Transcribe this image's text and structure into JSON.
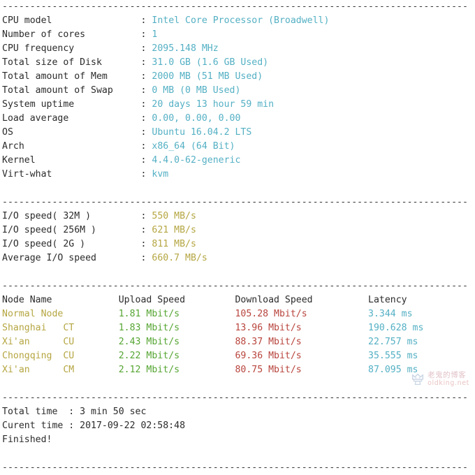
{
  "terminal": {
    "separator": "----------------------------------------------------------------------",
    "colors": {
      "foreground": "#2b2b2b",
      "background": "#ffffff",
      "cyan": "#54b0c4",
      "olive": "#b5a642",
      "green": "#55a532",
      "red": "#b8443c"
    }
  },
  "system_info": [
    {
      "label": "CPU model",
      "value": "Intel Core Processor (Broadwell)"
    },
    {
      "label": "Number of cores",
      "value": "1"
    },
    {
      "label": "CPU frequency",
      "value": "2095.148 MHz"
    },
    {
      "label": "Total size of Disk",
      "value": "31.0 GB (1.6 GB Used)"
    },
    {
      "label": "Total amount of Mem",
      "value": "2000 MB (51 MB Used)"
    },
    {
      "label": "Total amount of Swap",
      "value": "0 MB (0 MB Used)"
    },
    {
      "label": "System uptime",
      "value": "20 days 13 hour 59 min"
    },
    {
      "label": "Load average",
      "value": "0.00, 0.00, 0.00"
    },
    {
      "label": "OS",
      "value": "Ubuntu 16.04.2 LTS"
    },
    {
      "label": "Arch",
      "value": "x86_64 (64 Bit)"
    },
    {
      "label": "Kernel",
      "value": "4.4.0-62-generic"
    },
    {
      "label": "Virt-what",
      "value": "kvm"
    }
  ],
  "io_speed": [
    {
      "label": "I/O speed( 32M )",
      "value": "550 MB/s"
    },
    {
      "label": "I/O speed( 256M )",
      "value": "621 MB/s"
    },
    {
      "label": "I/O speed( 2G )",
      "value": "811 MB/s"
    },
    {
      "label": "Average I/O speed",
      "value": "660.7 MB/s"
    }
  ],
  "speedtest": {
    "headers": {
      "node": "Node Name",
      "upload": "Upload Speed",
      "download": "Download Speed",
      "latency": "Latency"
    },
    "rows": [
      {
        "node": "Normal Node",
        "isp": "",
        "upload": "1.81 Mbit/s",
        "download": "105.28 Mbit/s",
        "latency": "3.344 ms"
      },
      {
        "node": "Shanghai",
        "isp": "CT",
        "upload": "1.83 Mbit/s",
        "download": "13.96 Mbit/s",
        "latency": "190.628 ms"
      },
      {
        "node": "Xi'an",
        "isp": "CU",
        "upload": "2.43 Mbit/s",
        "download": "88.37 Mbit/s",
        "latency": "22.757 ms"
      },
      {
        "node": "Chongqing",
        "isp": "CU",
        "upload": "2.22 Mbit/s",
        "download": "69.36 Mbit/s",
        "latency": "35.555 ms"
      },
      {
        "node": "Xi'an",
        "isp": "CM",
        "upload": "2.12 Mbit/s",
        "download": "80.75 Mbit/s",
        "latency": "87.095 ms"
      }
    ]
  },
  "summary": [
    {
      "label": "Total time",
      "value": "3 min 50 sec"
    },
    {
      "label": "Curent time",
      "value": "2017-09-22 02:58:48"
    }
  ],
  "status": "Finished!",
  "watermark": {
    "logo": "crown-icon",
    "chinese": "老鬼的博客",
    "site": "oldking.net"
  }
}
